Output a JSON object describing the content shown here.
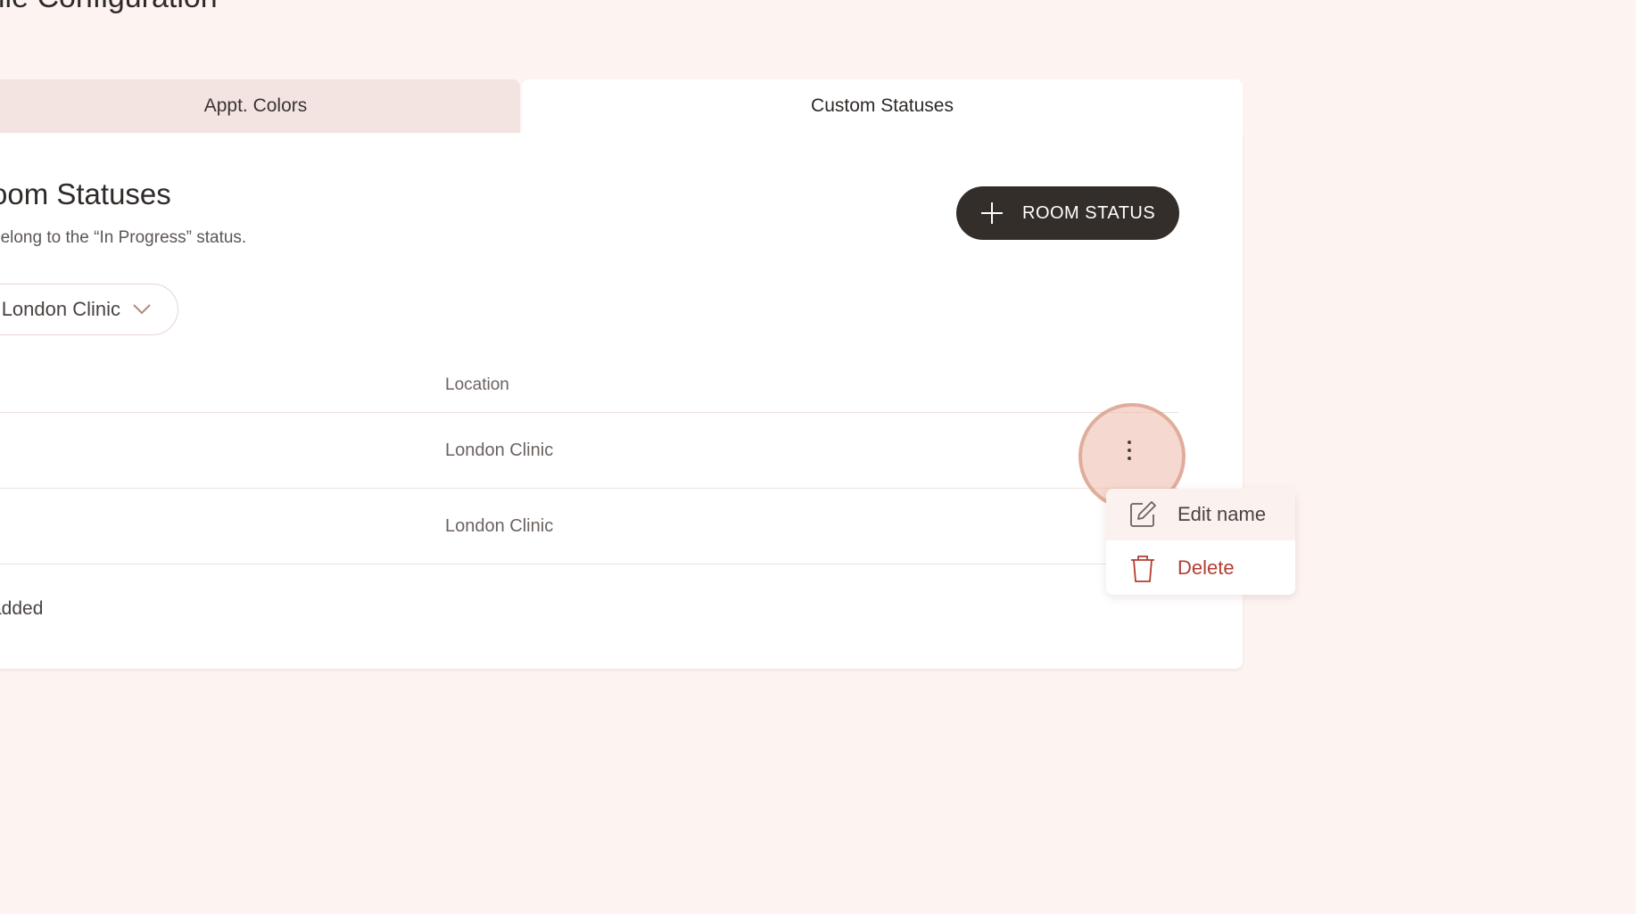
{
  "page": {
    "title": "ile Configuration"
  },
  "tabs": [
    {
      "label": "Appt. Colors",
      "selected": false
    },
    {
      "label": "Custom Statuses",
      "selected": true
    }
  ],
  "section": {
    "title": "oom Statuses",
    "subtitle": "belong to the “In Progress” status.",
    "add_button_label": "ROOM STATUS"
  },
  "location_filter": {
    "value": "London Clinic"
  },
  "table": {
    "columns": [
      "Location"
    ],
    "rows": [
      {
        "location": "London Clinic"
      },
      {
        "location": "London Clinic"
      }
    ],
    "empty_text": "added"
  },
  "row_menu": {
    "items": [
      {
        "label": "Edit name",
        "icon": "edit-icon"
      },
      {
        "label": "Delete",
        "icon": "trash-icon"
      }
    ]
  },
  "colors": {
    "background": "#fdf4f2",
    "primary_button": "#342e2b",
    "danger": "#b33d33",
    "highlight_ring": "#d69682"
  }
}
